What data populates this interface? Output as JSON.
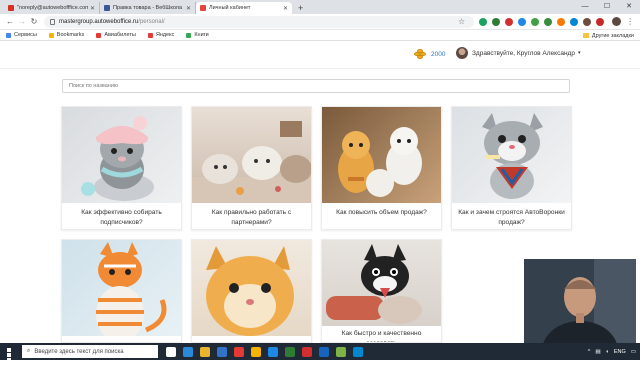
{
  "browser": {
    "tabs": [
      {
        "label": "\"noreply@autowebofffice.com\"",
        "fav_color": "#d93025",
        "active": false
      },
      {
        "label": "Правка товара - ВебШкола",
        "fav_color": "#3b5998",
        "active": false
      },
      {
        "label": "Личный кабинет",
        "fav_color": "#e8443a",
        "active": true
      }
    ],
    "new_tab_label": "+",
    "url_host": "mastergroup.autoweboffice.ru",
    "url_path": "/personal/",
    "bookmarks": [
      {
        "label": "Сервисы",
        "color": "#4285f4"
      },
      {
        "label": "Bookmarks",
        "color": "#f5b400"
      },
      {
        "label": "Авиабилеты",
        "color": "#e53935"
      },
      {
        "label": "Яндекс",
        "color": "#e53935"
      },
      {
        "label": "Книги",
        "color": "#34a853"
      }
    ],
    "other_bookmarks": "Другие закладки",
    "extension_colors": [
      "#1aa260",
      "#2e7d32",
      "#d32f2f",
      "#1e88e5",
      "#43a047",
      "#388e3c",
      "#f57c00",
      "#0288d1",
      "#6d4c41",
      "#c62828"
    ]
  },
  "header": {
    "coins": "2000",
    "greeting": "Здравствуйте, Круглов Александр",
    "caret": "▾"
  },
  "search": {
    "placeholder": "Поиск по названию"
  },
  "cards": [
    {
      "title": "Как эффективно собирать подписчиков?",
      "theme": "cat1"
    },
    {
      "title": "Как правильно работать с партнерами?",
      "theme": "cats2"
    },
    {
      "title": "Как повысить объем продаж?",
      "theme": "cats3"
    },
    {
      "title": "Как и зачем строятся АвтоВоронки продаж?",
      "theme": "cat4"
    },
    {
      "title": "",
      "theme": "cat5"
    },
    {
      "title": "",
      "theme": "cat6"
    },
    {
      "title": "Как быстро и качественно создавать",
      "theme": "cat7"
    }
  ],
  "taskbar": {
    "search_placeholder": "Введите здесь текст для поиска",
    "lang": "ENG",
    "app_colors": [
      "#ffffff",
      "#2b89d9",
      "#e9b52e",
      "#2f74c8",
      "#e53935",
      "#f4b400",
      "#1e88e5",
      "#2e7d32",
      "#d32f2f",
      "#1565c0",
      "#7cb342",
      "#0288d1"
    ]
  }
}
